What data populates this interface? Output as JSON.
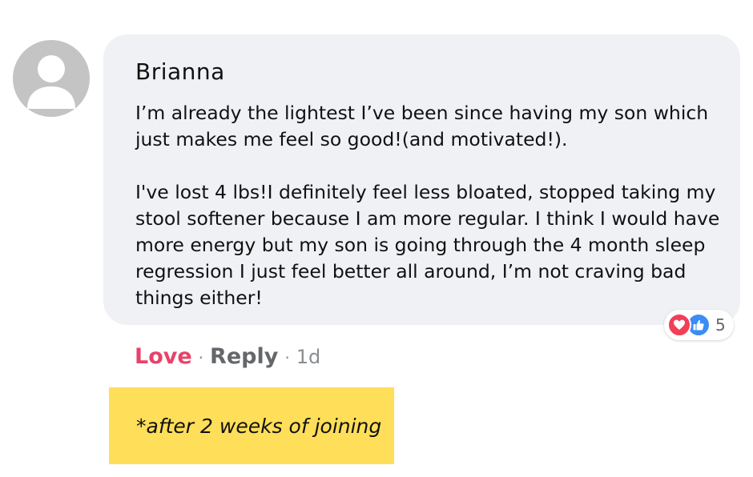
{
  "comment": {
    "author": "Brianna",
    "paragraphs": [
      "I’m already the lightest I’ve been since having my son which just makes me feel so good!(and motivated!).",
      "I've lost 4 lbs!I definitely feel less bloated, stopped taking my stool softener because I am more regular. I think I would have more energy but my son is going through the 4 month sleep regression I just feel better all around, I’m not craving bad things either!"
    ],
    "reactions": {
      "icons": [
        "heart-icon",
        "thumbs-up-icon"
      ],
      "count": "5",
      "colors": {
        "love": "#f33e58",
        "like": "#3b8df5"
      }
    },
    "actions": {
      "love_label": "Love",
      "separator": "·",
      "reply_label": "Reply",
      "time": "1d",
      "love_color": "#e8426a"
    }
  },
  "note": {
    "text": "*after 2 weeks of joining",
    "background": "#ffde59"
  }
}
